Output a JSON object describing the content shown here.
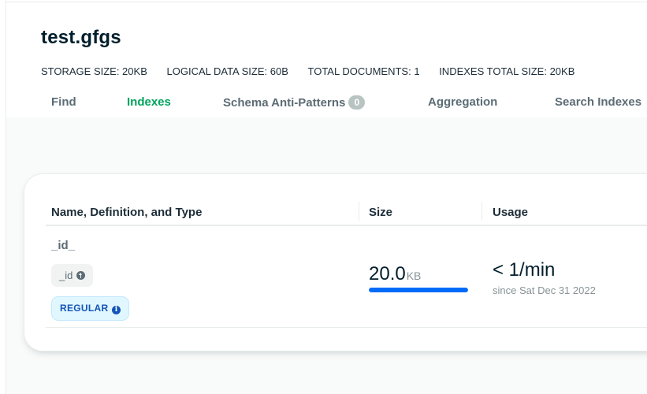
{
  "collection": {
    "title": "test.gfgs",
    "stats": [
      "STORAGE SIZE: 20KB",
      "LOGICAL DATA SIZE: 60B",
      "TOTAL DOCUMENTS: 1",
      "INDEXES TOTAL SIZE: 20KB"
    ]
  },
  "tabs": [
    {
      "label": "Find",
      "active": false
    },
    {
      "label": "Indexes",
      "active": true
    },
    {
      "label": "Schema Anti-Patterns",
      "badge": "0",
      "active": false
    },
    {
      "label": "Aggregation",
      "active": false
    },
    {
      "label": "Search Indexes",
      "active": false
    }
  ],
  "table": {
    "columns": [
      "Name, Definition, and Type",
      "Size",
      "Usage"
    ],
    "rows": [
      {
        "name": "_id_",
        "key": "_id",
        "key_direction_icon": "arrow-up-circle-icon",
        "type": "REGULAR",
        "type_icon": "info-icon",
        "size_value": "20.0",
        "size_unit": "KB",
        "size_fraction": 1.0,
        "usage": "< 1/min",
        "usage_since": "since Sat Dec 31 2022"
      }
    ]
  },
  "colors": {
    "active_tab": "#00a35c",
    "size_bar": "#016bf8",
    "badge_bg": "#e1f7ff",
    "badge_text": "#1254b7"
  }
}
